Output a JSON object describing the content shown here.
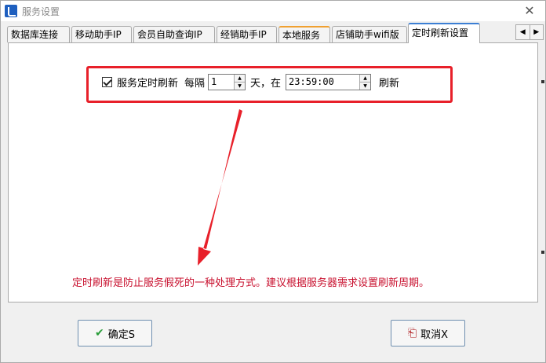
{
  "window": {
    "title": "服务设置",
    "close_label": "✕"
  },
  "tabs": [
    {
      "label": "数据库连接"
    },
    {
      "label": "移动助手IP"
    },
    {
      "label": "会员自助查询IP"
    },
    {
      "label": "经销助手IP"
    },
    {
      "label": "本地服务"
    },
    {
      "label": "店铺助手wifi版"
    },
    {
      "label": "定时刷新设置"
    }
  ],
  "tab_scroll": {
    "left": "◀",
    "right": "▶"
  },
  "refresh": {
    "checkbox_label": "服务定时刷新",
    "every_label": "每隔",
    "interval_value": "1",
    "day_label": "天，在",
    "time_value": "23:59:00",
    "refresh_label": "刷新",
    "checked": true
  },
  "note": "定时刷新是防止服务假死的一种处理方式。建议根据服务器需求设置刷新周期。",
  "buttons": {
    "ok_label": "确定S",
    "cancel_label": "取消X"
  },
  "colors": {
    "highlight": "#e8202a",
    "note": "#c8102e",
    "active_tab": "#3c7fd4"
  }
}
